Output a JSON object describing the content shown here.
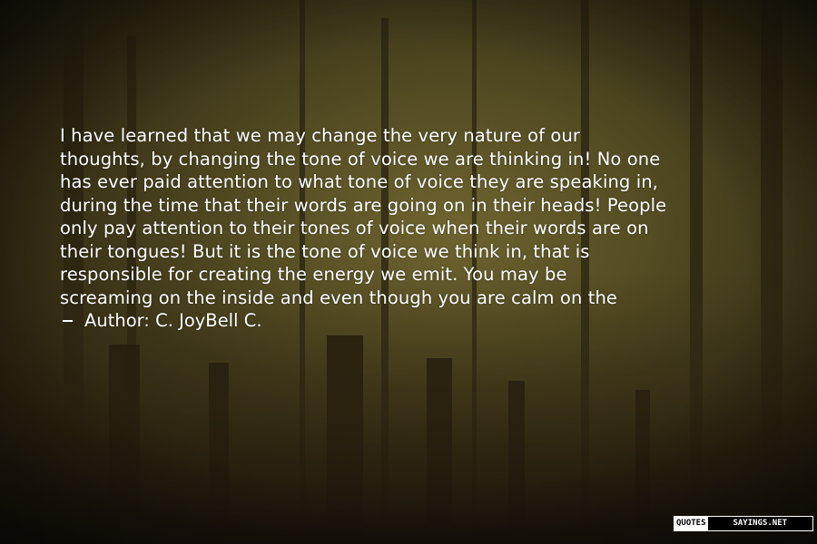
{
  "quote": {
    "lines": [
      "I have learned that we may change the very nature of our",
      "thoughts, by changing the tone of voice we are thinking in! No one",
      "has ever paid attention to what tone of voice they are speaking in,",
      "during the time that their words are going on in their heads! People",
      "only pay attention to their tones of voice when their words are on",
      "their tongues! But it is the tone of voice we think in, that is",
      "responsible for creating the energy we emit. You may be",
      "screaming on the inside and even though you are calm on the"
    ],
    "author_label": "Author: C. JoyBell C."
  },
  "watermark": {
    "left": "QUOTES",
    "right": "SAYINGS.NET"
  },
  "colors": {
    "text": "#ffffff",
    "background": "#2a2412"
  }
}
